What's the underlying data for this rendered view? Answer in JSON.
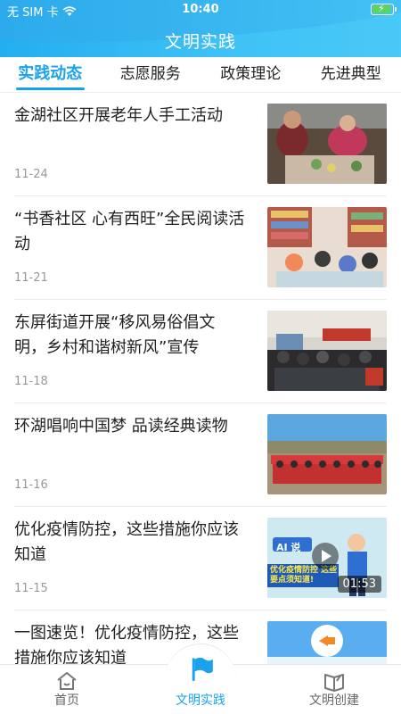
{
  "status": {
    "carrier": "无 SIM 卡",
    "time": "10:40"
  },
  "header": {
    "title": "文明实践"
  },
  "tabs": [
    {
      "label": "实践动态",
      "active": true
    },
    {
      "label": "志愿服务",
      "active": false
    },
    {
      "label": "政策理论",
      "active": false
    },
    {
      "label": "先进典型",
      "active": false
    }
  ],
  "news": [
    {
      "title": "金湖社区开展老年人手工活动",
      "date": "11-24"
    },
    {
      "title": "“书香社区 心有西旺”全民阅读活动",
      "date": "11-21"
    },
    {
      "title": "东屏街道开展“移风易俗倡文明，乡村和谐树新风”宣传",
      "date": "11-18"
    },
    {
      "title": "环湖唱响中国梦 品读经典读物",
      "date": "11-16"
    },
    {
      "title": "优化疫情防控，这些措施你应该知道",
      "date": "11-15",
      "video_duration": "01:53",
      "thumb_text": "AI 说",
      "thumb_caption": "优化疫情防控 这些要点须知道!"
    },
    {
      "title": "一图速览！优化疫情防控，这些措施你应该知道",
      "date": ""
    }
  ],
  "bottom_nav": [
    {
      "label": "首页",
      "icon": "home-icon",
      "active": false
    },
    {
      "label": "文明实践",
      "icon": "flag-icon",
      "active": true
    },
    {
      "label": "文明创建",
      "icon": "book-icon",
      "active": false
    }
  ],
  "colors": {
    "accent": "#1aa2ef",
    "header_gradient_start": "#23aef0",
    "header_wave": "#f4c23a"
  }
}
